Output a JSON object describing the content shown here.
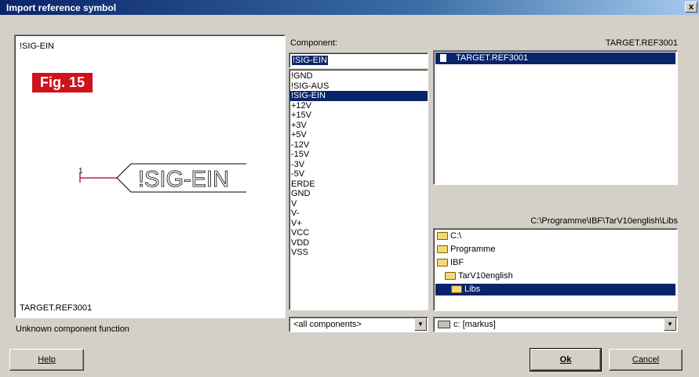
{
  "window": {
    "title": "Import reference symbol",
    "close_label": "x"
  },
  "preview": {
    "top_name": "!SIG-EIN",
    "bottom_name": "TARGET.REF3001",
    "fig_label": "Fig. 15",
    "symbol_pin": "1",
    "symbol_text": "!SIG-EIN",
    "status": "Unknown component function"
  },
  "component": {
    "label": "Component:",
    "input_value": "!SIG-EIN",
    "items": [
      "!GND",
      "!SIG-AUS",
      "!SIG-EIN",
      "+12V",
      "+15V",
      "+3V",
      "+5V",
      "-12V",
      "-15V",
      "-3V",
      "-5V",
      "ERDE",
      "GND",
      "V",
      "V-",
      "V+",
      "VCC",
      "VDD",
      "VSS"
    ],
    "selected": "!SIG-EIN",
    "filter_value": "<all components>"
  },
  "files": {
    "header": "TARGET.REF3001",
    "items": [
      "TARGET.REF3001"
    ]
  },
  "directories": {
    "path": "C:\\Programme\\IBF\\TarV10english\\Libs",
    "items": [
      "C:\\",
      "Programme",
      "IBF",
      "TarV10english",
      "Libs"
    ],
    "selected": "Libs",
    "drive_value": "c: [markus]"
  },
  "buttons": {
    "help": "Help",
    "ok": "Ok",
    "cancel": "Cancel"
  },
  "colors": {
    "selection": "#0a246a",
    "fig_badge": "#d0121b",
    "dialog_bg": "#d4d0c8"
  }
}
